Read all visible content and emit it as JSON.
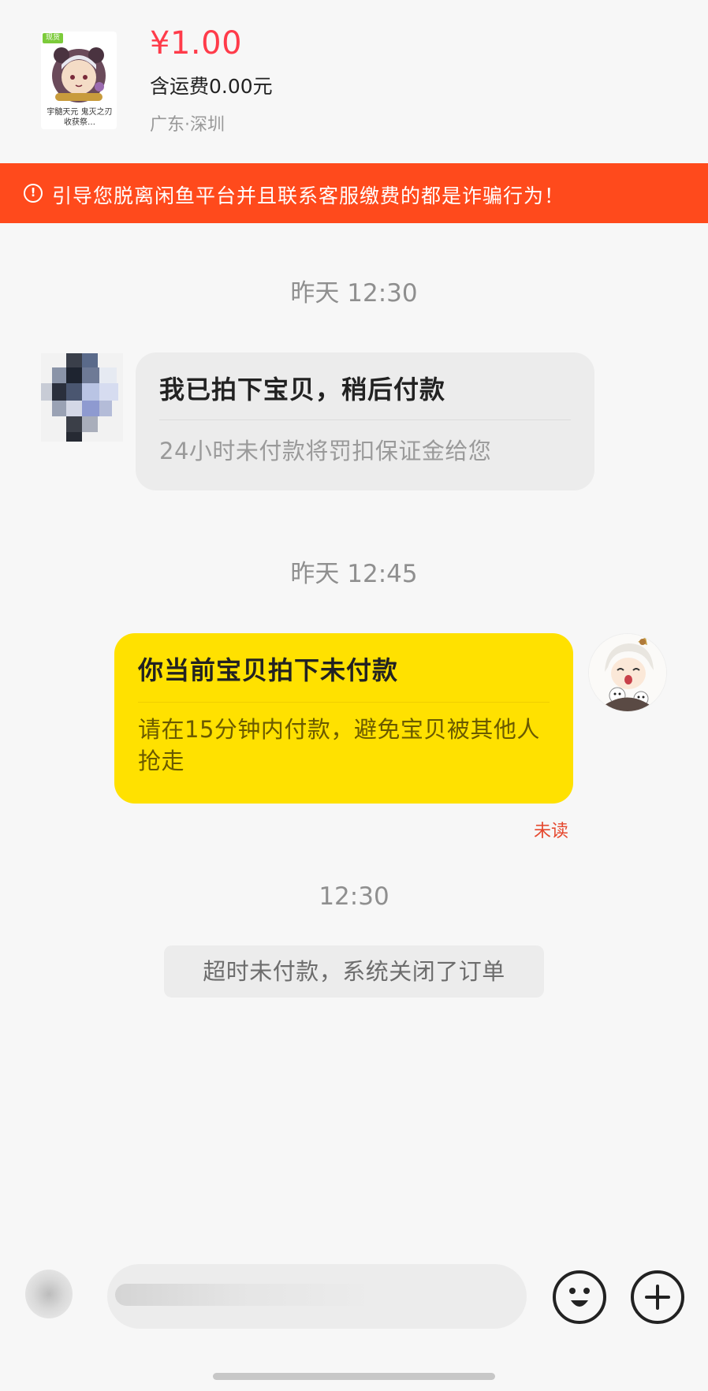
{
  "product": {
    "thumbnail_badge": "现货",
    "thumbnail_caption": "宇髓天元 鬼灭之刃 收获祭…",
    "price": "¥1.00",
    "shipping": "含运费0.00元",
    "location": "广东·深圳"
  },
  "warning_banner": {
    "icon": "alert-circle-icon",
    "text": "引导您脱离闲鱼平台并且联系客服缴费的都是诈骗行为！",
    "color": "#ff4a1c"
  },
  "messages": [
    {
      "time": "昨天 12:30",
      "side": "left",
      "title": "我已拍下宝贝，稍后付款",
      "subtitle": "24小时未付款将罚扣保证金给您"
    },
    {
      "time": "昨天 12:45",
      "side": "right",
      "title": "你当前宝贝拍下未付款",
      "subtitle": "请在15分钟内付款，避免宝贝被其他人抢走",
      "status": "未读"
    },
    {
      "time": "12:30",
      "system_text": "超时未付款，系统关闭了订单"
    }
  ],
  "input_bar": {
    "voice_icon": "voice-icon",
    "placeholder": "",
    "emoji_icon": "emoji-icon",
    "plus_icon": "plus-icon"
  },
  "colors": {
    "price_red": "#ff3b4a",
    "bubble_yellow": "#ffe100",
    "unread_red": "#e5482e",
    "background": "#f7f7f7"
  }
}
